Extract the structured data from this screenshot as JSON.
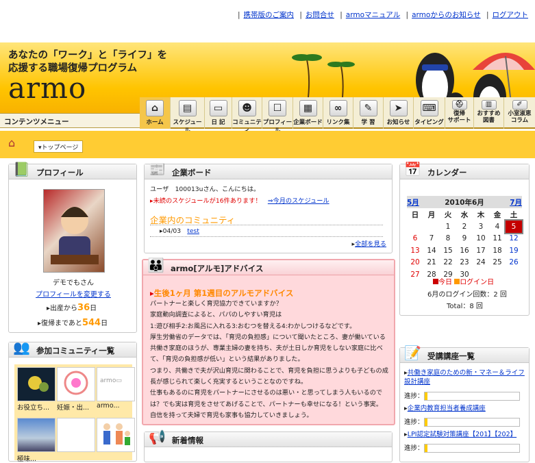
{
  "toplinks": [
    "携帯版のご案内",
    "お問合せ",
    "armoマニュアル",
    "armoからのお知らせ",
    "ログアウト"
  ],
  "header": {
    "tagline1": "あなたの「ワーク」と「ライフ」を",
    "tagline2": "応援する職場復帰プログラム",
    "logo": "armo"
  },
  "content_menu": "コンテンツメニュー",
  "nav": [
    {
      "label": "ホーム",
      "icon": "house-icon"
    },
    {
      "label": "スケジュール",
      "icon": "schedule-icon"
    },
    {
      "label": "日 記",
      "icon": "diary-icon"
    },
    {
      "label": "コミュニティ",
      "icon": "community-icon"
    },
    {
      "label": "プロフィール",
      "icon": "profile-icon"
    },
    {
      "label": "企業ボード",
      "icon": "board-icon"
    },
    {
      "label": "リンク集",
      "icon": "link-icon"
    },
    {
      "label": "学 習",
      "icon": "study-icon"
    },
    {
      "label": "お知らせ",
      "icon": "notice-icon"
    },
    {
      "label": "タイピング",
      "icon": "keyboard-icon"
    },
    {
      "label": "復帰サポート",
      "l1": "復帰",
      "l2": "サポート",
      "icon": "support-icon"
    },
    {
      "label": "おすすめ図書",
      "l1": "おすすめ",
      "l2": "図書",
      "icon": "book-icon"
    },
    {
      "label": "小室淑恵コラム",
      "l1": "小室淑恵",
      "l2": "コラム",
      "icon": "column-icon"
    }
  ],
  "breadcrumb": "トップページ",
  "profile": {
    "title": "プロフィール",
    "name": "デモでもさん",
    "edit": "プロフィールを変更する",
    "since_pre": "出産から",
    "since_num": "36",
    "since_post": "日",
    "until_pre": "復帰まであと",
    "until_num": "544",
    "until_post": "日"
  },
  "communities": {
    "title": "参加コミュニティ一覧",
    "items": [
      "お役立ち...",
      "妊娠・出...",
      "armo...",
      "",
      ""
    ]
  },
  "board": {
    "title": "企業ボード",
    "greeting": "ユーザ　100013uさん、こんにちは。",
    "unread": "未読のスケジュールが16件あります！",
    "month_link": "⇒今月のスケジュール",
    "community_title": "企業内のコミュニティ",
    "post_date": "04/03",
    "post_link": "test",
    "all": "全部を見る"
  },
  "advice": {
    "title": "armo[アルモ]アドバイス",
    "heading": "生後1ヶ月 第1週目のアルモアドバイス",
    "lines": [
      "パートナーと楽しく育児協力できていますか？",
      "家庭動向調査によると、パパのしやすい育児は",
      "1:遊び相手2:お風呂に入れる3:おむつを替える4:わかしつけるなどです。",
      "厚生労働省のデータでは、「育児の負担感」について聞いたところ、妻が働いている",
      "共働き家庭のほうが、専業主婦の妻を持ち、夫が土日しか育児をしない家庭に比べ",
      "て、「育児の負担感が低い」という結果がありました。",
      "つまり、共働きで夫が沢山育児に関わることで、育児を負担に思うよりも子どもの成",
      "長が感じられて楽しく充実するということなのですね。",
      "仕事もあるのに育児をパートナーにさせるのは悪い・と思ってしまう人もいるので",
      "は？でも実は育児をさせてあげることで、パートナーも幸せになる！という事実。",
      "自信を持って夫婦で育児も家事も協力していきましょう。"
    ]
  },
  "news": {
    "title": "新着情報"
  },
  "calendar": {
    "title": "カレンダー",
    "prev": "5月",
    "month": "2010年6月",
    "next": "7月",
    "weekdays": [
      "日",
      "月",
      "火",
      "水",
      "木",
      "金",
      "土"
    ],
    "weeks": [
      [
        "",
        "",
        "1",
        "2",
        "3",
        "4",
        "5"
      ],
      [
        "6",
        "7",
        "8",
        "9",
        "10",
        "11",
        "12"
      ],
      [
        "13",
        "14",
        "15",
        "16",
        "17",
        "18",
        "19"
      ],
      [
        "20",
        "21",
        "22",
        "23",
        "24",
        "25",
        "26"
      ],
      [
        "27",
        "28",
        "29",
        "30",
        "",
        "",
        ""
      ]
    ],
    "today": "5",
    "legend_today": "今日",
    "legend_login": "ログイン日",
    "logins": "6月のログイン回数：2 回",
    "total": "Total：8 回"
  },
  "courses": {
    "title": "受講講座一覧",
    "progress_label": "進捗：",
    "items": [
      {
        "name": "共働き家庭のための新・マネー＆ライフ設計講座",
        "progress": 0.03
      },
      {
        "name": "企業内教育担当者養成講座",
        "progress": 0.03
      },
      {
        "name": "LPI認定試験対策講座【201】【202】",
        "progress": 0.03
      }
    ]
  },
  "colors": {
    "header": "#ffc400",
    "accent": "#ffcc33",
    "pink": "#ffd9dc",
    "link": "#0033cc",
    "red": "#e00000",
    "orange": "#ff9900"
  }
}
